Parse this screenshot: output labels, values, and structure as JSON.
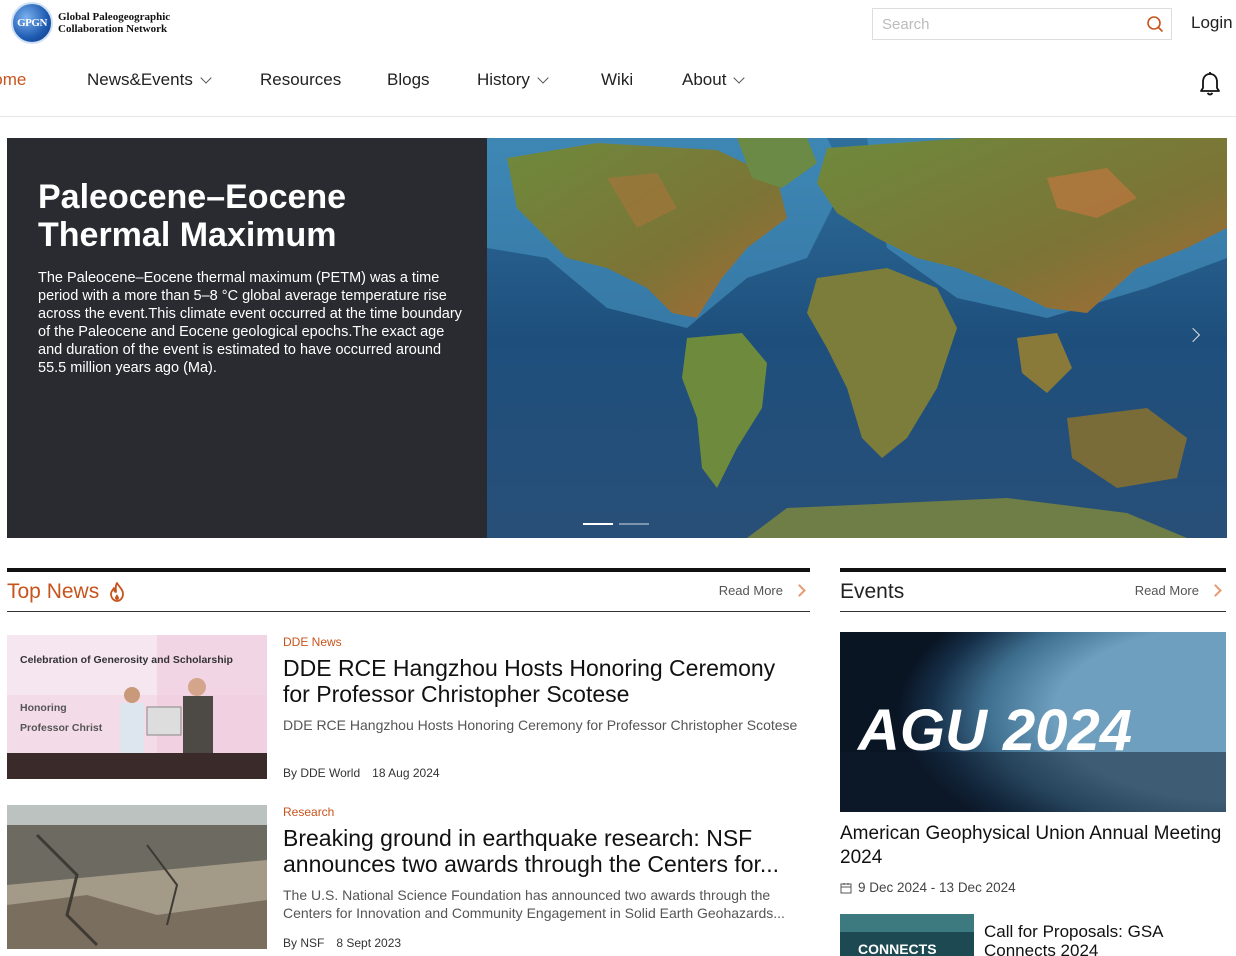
{
  "logo": {
    "badge": "GPGN",
    "line1": "Global Paleogeographic",
    "line2": "Collaboration Network"
  },
  "search": {
    "placeholder": "Search"
  },
  "login_label": "Login",
  "nav": [
    {
      "label": "Home",
      "active": true
    },
    {
      "label": "News&Events",
      "dropdown": true
    },
    {
      "label": "Resources"
    },
    {
      "label": "Blogs"
    },
    {
      "label": "History",
      "dropdown": true
    },
    {
      "label": "Wiki"
    },
    {
      "label": "About",
      "dropdown": true
    }
  ],
  "hero": {
    "title": "Paleocene–Eocene Thermal Maximum",
    "description": "The Paleocene–Eocene thermal maximum (PETM) was a time period with a more than 5–8 °C global average temperature rise across the event.This climate event occurred at the time boundary of the Paleocene and Eocene geological epochs.The exact age and duration of the event is estimated to have occurred around 55.5 million years ago (Ma)."
  },
  "top_news": {
    "title": "Top News",
    "read_more": "Read More",
    "items": [
      {
        "category": "DDE News",
        "title": "DDE RCE Hangzhou Hosts Honoring Ceremony for Professor Christopher Scotese",
        "summary": "DDE RCE Hangzhou Hosts Honoring Ceremony for Professor Christopher Scotese",
        "author": "By DDE World",
        "date": "18 Aug 2024",
        "thumb_text": {
          "line1": "Celebration of Generosity and Scholarship",
          "line2": "Honoring",
          "line3": "Professor Christ"
        }
      },
      {
        "category": "Research",
        "title": "Breaking ground in earthquake research: NSF announces two awards through the Centers for...",
        "summary": "The U.S. National Science Foundation has announced two awards through the Centers for Innovation and Community Engagement in Solid Earth Geohazards...",
        "author": "By NSF",
        "date": "8 Sept 2023"
      }
    ]
  },
  "events": {
    "title": "Events",
    "read_more": "Read More",
    "items": [
      {
        "banner": "AGU 2024",
        "title": "American Geophysical Union Annual Meeting 2024",
        "date": "9 Dec 2024 - 13 Dec 2024"
      },
      {
        "title": "Call for Proposals: GSA Connects 2024",
        "banner_small": "CONNECTS"
      }
    ]
  },
  "colors": {
    "accent": "#c8541d",
    "hero_bg": "#2a2b30"
  }
}
